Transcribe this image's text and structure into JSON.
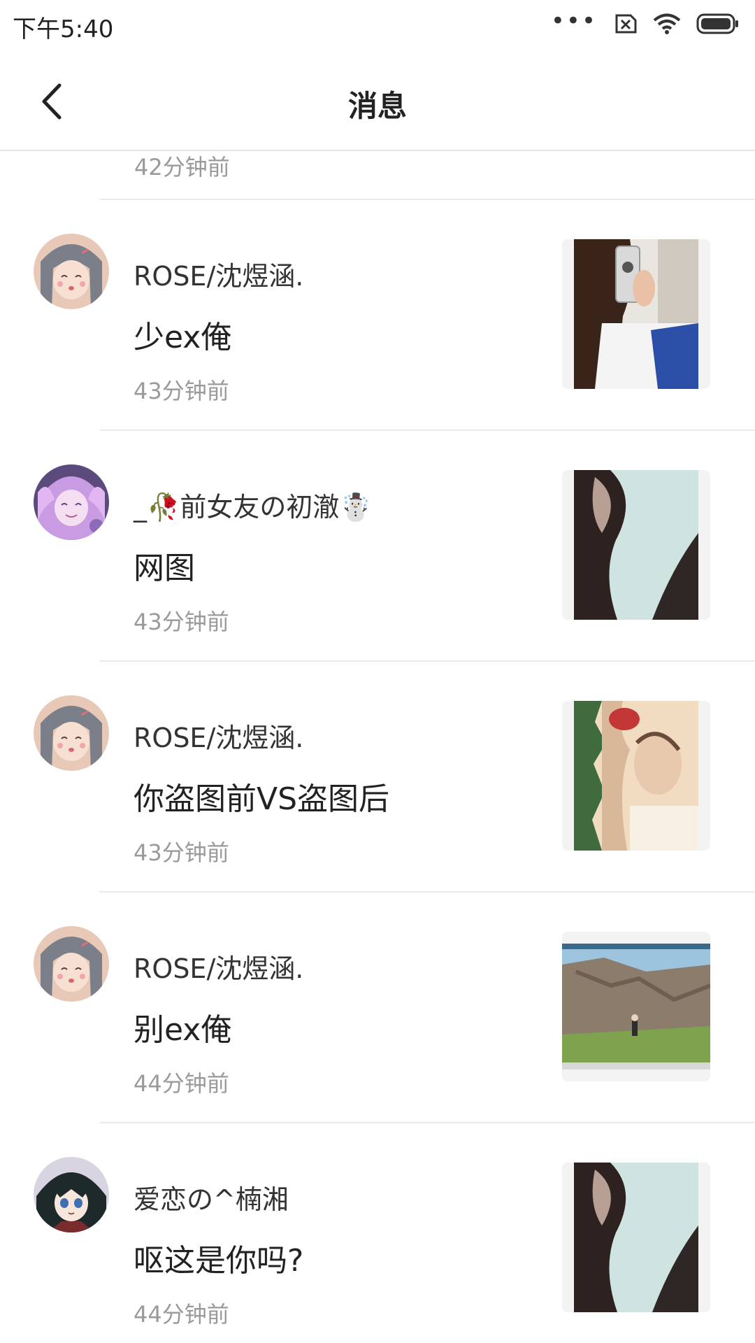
{
  "status_bar": {
    "time": "下午5:40",
    "dots": "•••",
    "icons": [
      "sim-off-icon",
      "wifi-icon",
      "battery-icon"
    ]
  },
  "header": {
    "title": "消息",
    "back_icon": "back-arrow-icon"
  },
  "partial_item": {
    "time": "42分钟前"
  },
  "messages": [
    {
      "name": "ROSE/沈煜涵.",
      "content": "少ex俺",
      "time": "43分钟前",
      "avatar": "anime-girl-gray-hair",
      "thumbnail": "selfie-photo"
    },
    {
      "name": "_🥀前女友の初澈☃️",
      "content": "网图",
      "time": "43分钟前",
      "avatar": "anime-girl-purple-hair",
      "thumbnail": "blurred-photo"
    },
    {
      "name": "ROSE/沈煜涵.",
      "content": "你盗图前VS盗图后",
      "time": "43分钟前",
      "avatar": "anime-girl-gray-hair",
      "thumbnail": "distorted-photo"
    },
    {
      "name": "ROSE/沈煜涵.",
      "content": "别ex俺",
      "time": "44分钟前",
      "avatar": "anime-girl-gray-hair",
      "thumbnail": "game-screenshot"
    },
    {
      "name": "爱恋の^楠湘",
      "content": "呕这是你吗?",
      "time": "44分钟前",
      "avatar": "anime-boy-dark-hair",
      "thumbnail": "blurred-photo"
    }
  ],
  "colors": {
    "divider": "#ebebeb",
    "secondary_text": "#9a9a9a",
    "primary_text": "#222222"
  }
}
